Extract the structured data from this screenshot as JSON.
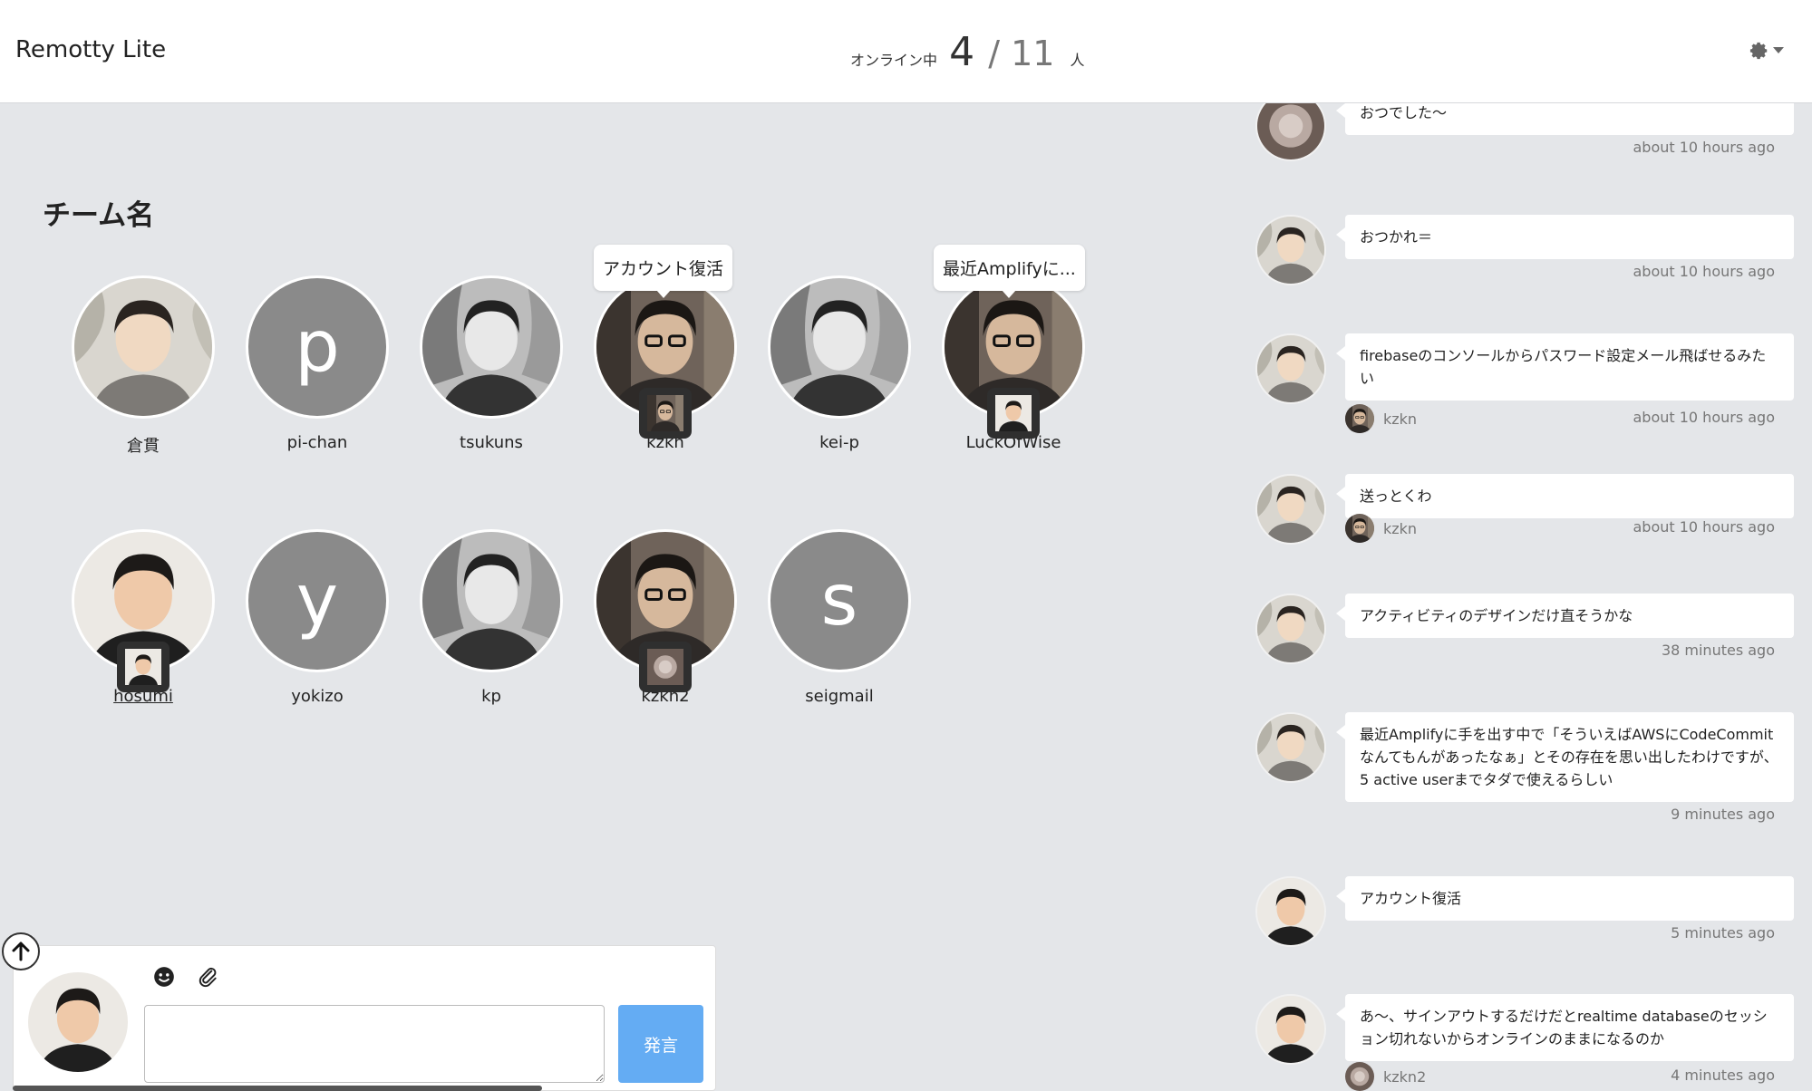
{
  "header": {
    "brand": "Remotty Lite",
    "online_label": "オンライン中",
    "online_count": "4",
    "total": "/ 11",
    "unit": "人",
    "settings_icon": "gear-icon"
  },
  "team": {
    "title": "チーム名",
    "members": [
      {
        "name": "倉貫"
      },
      {
        "name": "pi-chan",
        "initial": "p"
      },
      {
        "name": "tsukuns"
      },
      {
        "name": "kzkn",
        "status": "アカウント復活"
      },
      {
        "name": "kei-p"
      },
      {
        "name": "LuckOfWise",
        "status": "最近Amplifyに..."
      },
      {
        "name": "hosumi"
      },
      {
        "name": "yokizo",
        "initial": "y"
      },
      {
        "name": "kp"
      },
      {
        "name": "kzkn2"
      },
      {
        "name": "seigmail",
        "initial": "s"
      }
    ]
  },
  "feed": [
    {
      "message": "おつでした〜",
      "time": "about 10 hours ago"
    },
    {
      "message": "おつかれ＝",
      "time": "about 10 hours ago"
    },
    {
      "message": "firebaseのコンソールからパスワード設定メール飛ばせるみたい",
      "user": "kzkn",
      "time": "about 10 hours ago"
    },
    {
      "message": "送っとくわ",
      "user": "kzkn",
      "time": "about 10 hours ago"
    },
    {
      "message": "アクティビティのデザインだけ直そうかな",
      "time": "38 minutes ago"
    },
    {
      "message": "最近Amplifyに手を出す中で「そういえばAWSにCodeCommitなんてもんがあったなぁ」とその存在を思い出したわけですが、5 active userまでタダで使えるらしい",
      "time": "9 minutes ago"
    },
    {
      "message": "アカウント復活",
      "time": "5 minutes ago"
    },
    {
      "message": "あ〜、サインアウトするだけだとrealtime databaseのセッション切れないからオンラインのままになるのか",
      "user": "kzkn2",
      "time": "4 minutes ago"
    }
  ],
  "composer": {
    "placeholder": "",
    "send_label": "発言",
    "emoji_icon": "smiley-icon",
    "attach_icon": "paperclip-icon"
  }
}
